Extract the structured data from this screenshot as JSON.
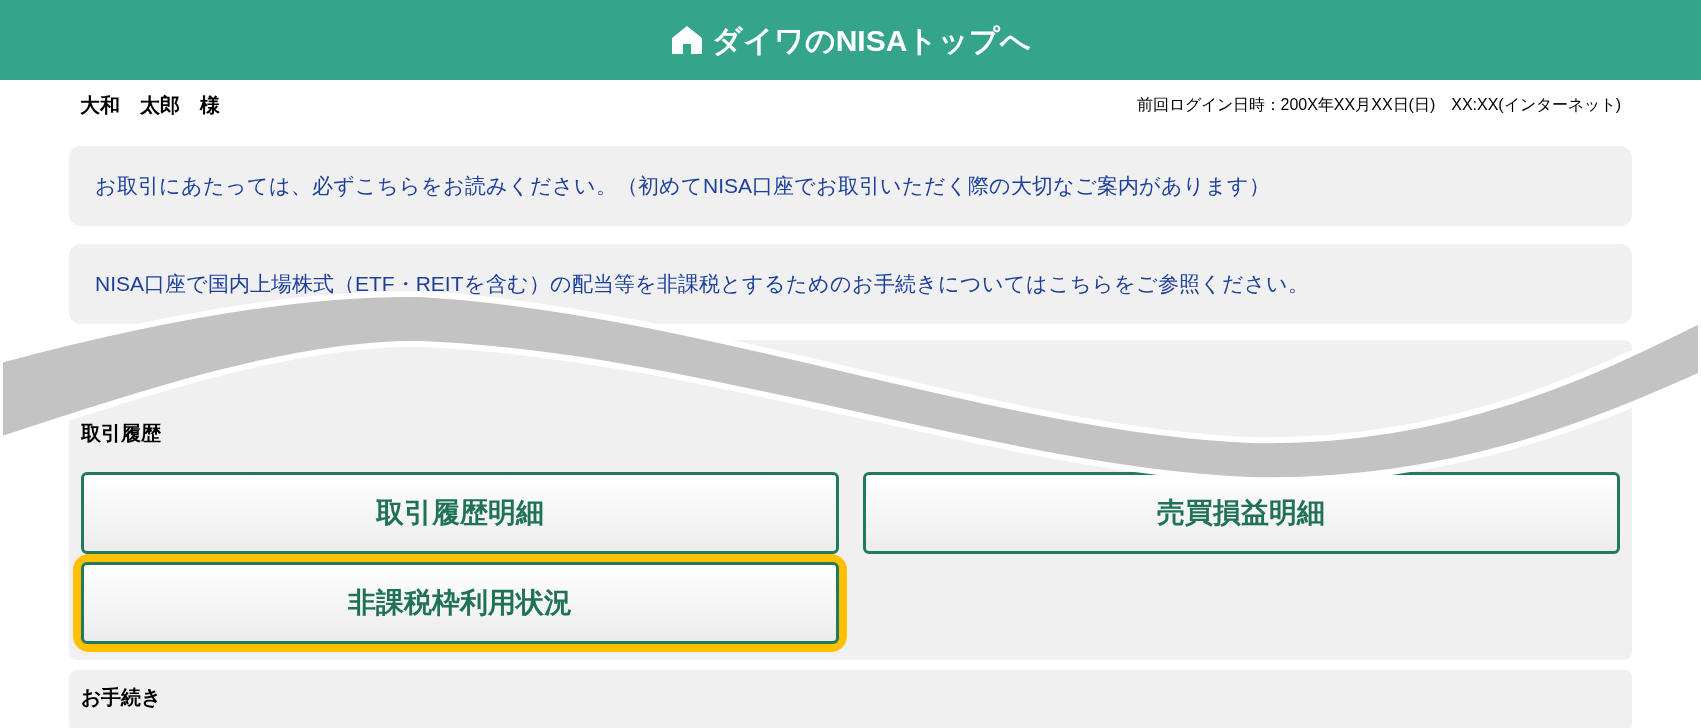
{
  "header": {
    "title": "ダイワのNISAトップへ"
  },
  "user": {
    "name": "大和　太郎　様",
    "last_login": "前回ログイン日時：200X年XX月XX日(日)　XX:XX(インターネット)"
  },
  "notices": [
    "お取引にあたっては、必ずこちらをお読みください。（初めてNISA口座でお取引いただく際の大切なご案内があります）",
    "NISA口座で国内上場株式（ETF・REITを含む）の配当等を非課税とするためのお手続きについてはこちらをご参照ください。"
  ],
  "sections": [
    {
      "title": "取引履歴",
      "buttons": [
        {
          "label": "取引履歴明細",
          "highlighted": false
        },
        {
          "label": "売買損益明細",
          "highlighted": false
        },
        {
          "label": "非課税枠利用状況",
          "highlighted": true
        }
      ]
    },
    {
      "title": "お手続き"
    }
  ]
}
